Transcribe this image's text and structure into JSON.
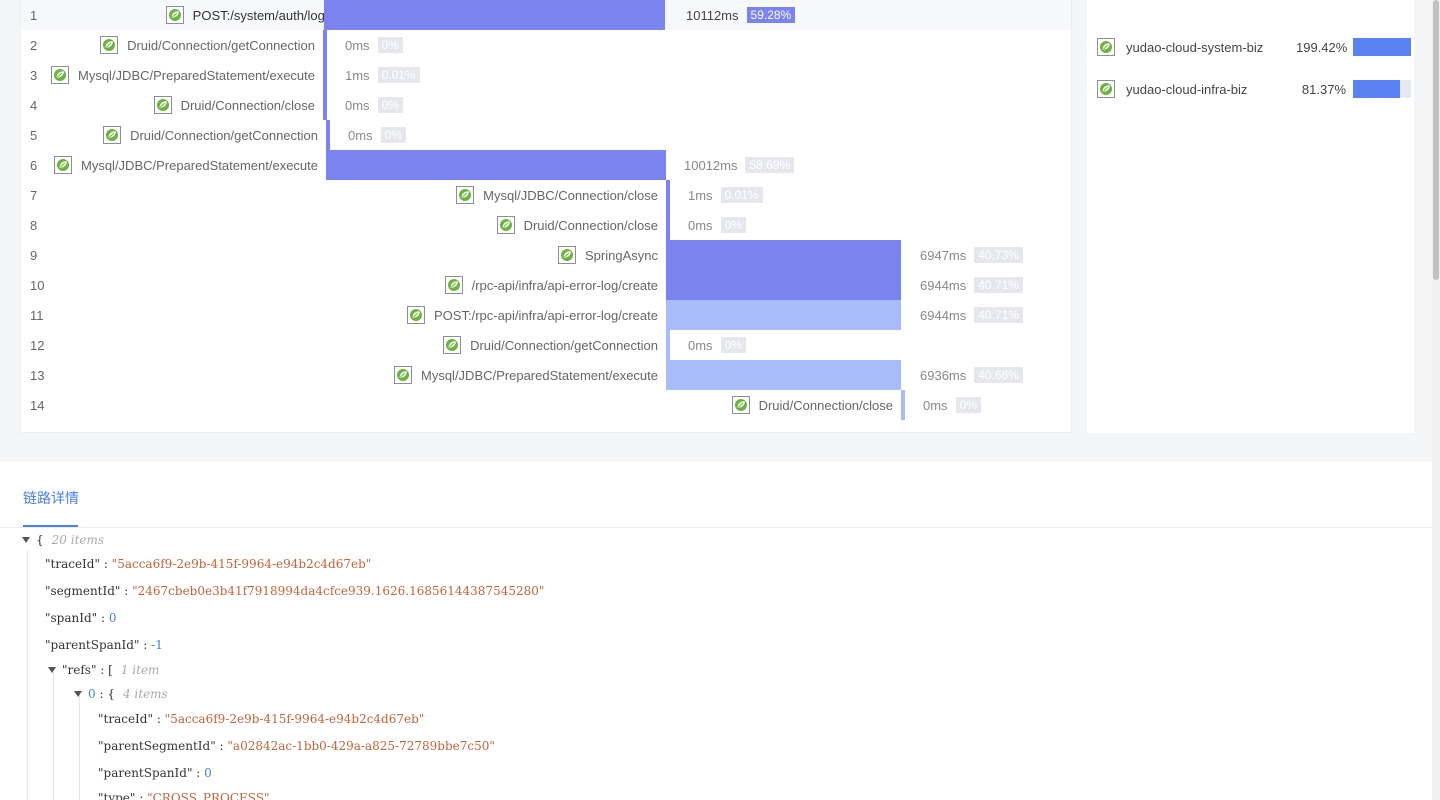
{
  "trace_rows": [
    {
      "num": "1",
      "label": "POST:/system/auth/login",
      "ms": "10112ms",
      "pct": "59.28%"
    },
    {
      "num": "2",
      "label": "Druid/Connection/getConnection",
      "ms": "0ms",
      "pct": "0%"
    },
    {
      "num": "3",
      "label": "Mysql/JDBC/PreparedStatement/execute",
      "ms": "1ms",
      "pct": "0.01%"
    },
    {
      "num": "4",
      "label": "Druid/Connection/close",
      "ms": "0ms",
      "pct": "0%"
    },
    {
      "num": "5",
      "label": "Druid/Connection/getConnection",
      "ms": "0ms",
      "pct": "0%"
    },
    {
      "num": "6",
      "label": "Mysql/JDBC/PreparedStatement/execute",
      "ms": "10012ms",
      "pct": "58.69%"
    },
    {
      "num": "7",
      "label": "Mysql/JDBC/Connection/close",
      "ms": "1ms",
      "pct": "0.01%"
    },
    {
      "num": "8",
      "label": "Druid/Connection/close",
      "ms": "0ms",
      "pct": "0%"
    },
    {
      "num": "9",
      "label": "SpringAsync",
      "ms": "6947ms",
      "pct": "40.73%"
    },
    {
      "num": "10",
      "label": "/rpc-api/infra/api-error-log/create",
      "ms": "6944ms",
      "pct": "40.71%"
    },
    {
      "num": "11",
      "label": "POST:/rpc-api/infra/api-error-log/create",
      "ms": "6944ms",
      "pct": "40.71%"
    },
    {
      "num": "12",
      "label": "Druid/Connection/getConnection",
      "ms": "0ms",
      "pct": "0%"
    },
    {
      "num": "13",
      "label": "Mysql/JDBC/PreparedStatement/execute",
      "ms": "6936ms",
      "pct": "40.66%"
    },
    {
      "num": "14",
      "label": "Druid/Connection/close",
      "ms": "0ms",
      "pct": "0%"
    }
  ],
  "services": [
    {
      "name": "yudao-cloud-system-biz",
      "pct": "199.42%",
      "fill": 1.0
    },
    {
      "name": "yudao-cloud-infra-biz",
      "pct": "81.37%",
      "fill": 0.8137
    }
  ],
  "icon_name": "spring-leaf-icon",
  "colors": {
    "span_bar": "#7b83f0",
    "span_bar_light": "#a9bcfa",
    "service_bar": "#5b82f5",
    "tab_active": "#4a7ef0"
  },
  "tab_label": "链路详情",
  "json_tree": {
    "root_meta": "20 items",
    "traceId_key": "\"traceId\"",
    "traceId_val": "\"5acca6f9-2e9b-415f-9964-e94b2c4d67eb\"",
    "segmentId_key": "\"segmentId\"",
    "segmentId_val": "\"2467cbeb0e3b41f7918994da4cfce939.1626.16856144387545280\"",
    "spanId_key": "\"spanId\"",
    "spanId_val": "0",
    "parentSpanId_key": "\"parentSpanId\"",
    "parentSpanId_val": "-1",
    "refs_key": "\"refs\"",
    "refs_meta": "1 item",
    "ref0_index": "0",
    "ref0_meta": "4 items",
    "ref_traceId_key": "\"traceId\"",
    "ref_traceId_val": "\"5acca6f9-2e9b-415f-9964-e94b2c4d67eb\"",
    "ref_parentSegmentId_key": "\"parentSegmentId\"",
    "ref_parentSegmentId_val": "\"a02842ac-1bb0-429a-a825-72789bbe7c50\"",
    "ref_parentSpanId_key": "\"parentSpanId\"",
    "ref_parentSpanId_val": "0",
    "ref_type_key": "\"type\"",
    "ref_type_val": "\"CROSS_PROCESS\""
  }
}
